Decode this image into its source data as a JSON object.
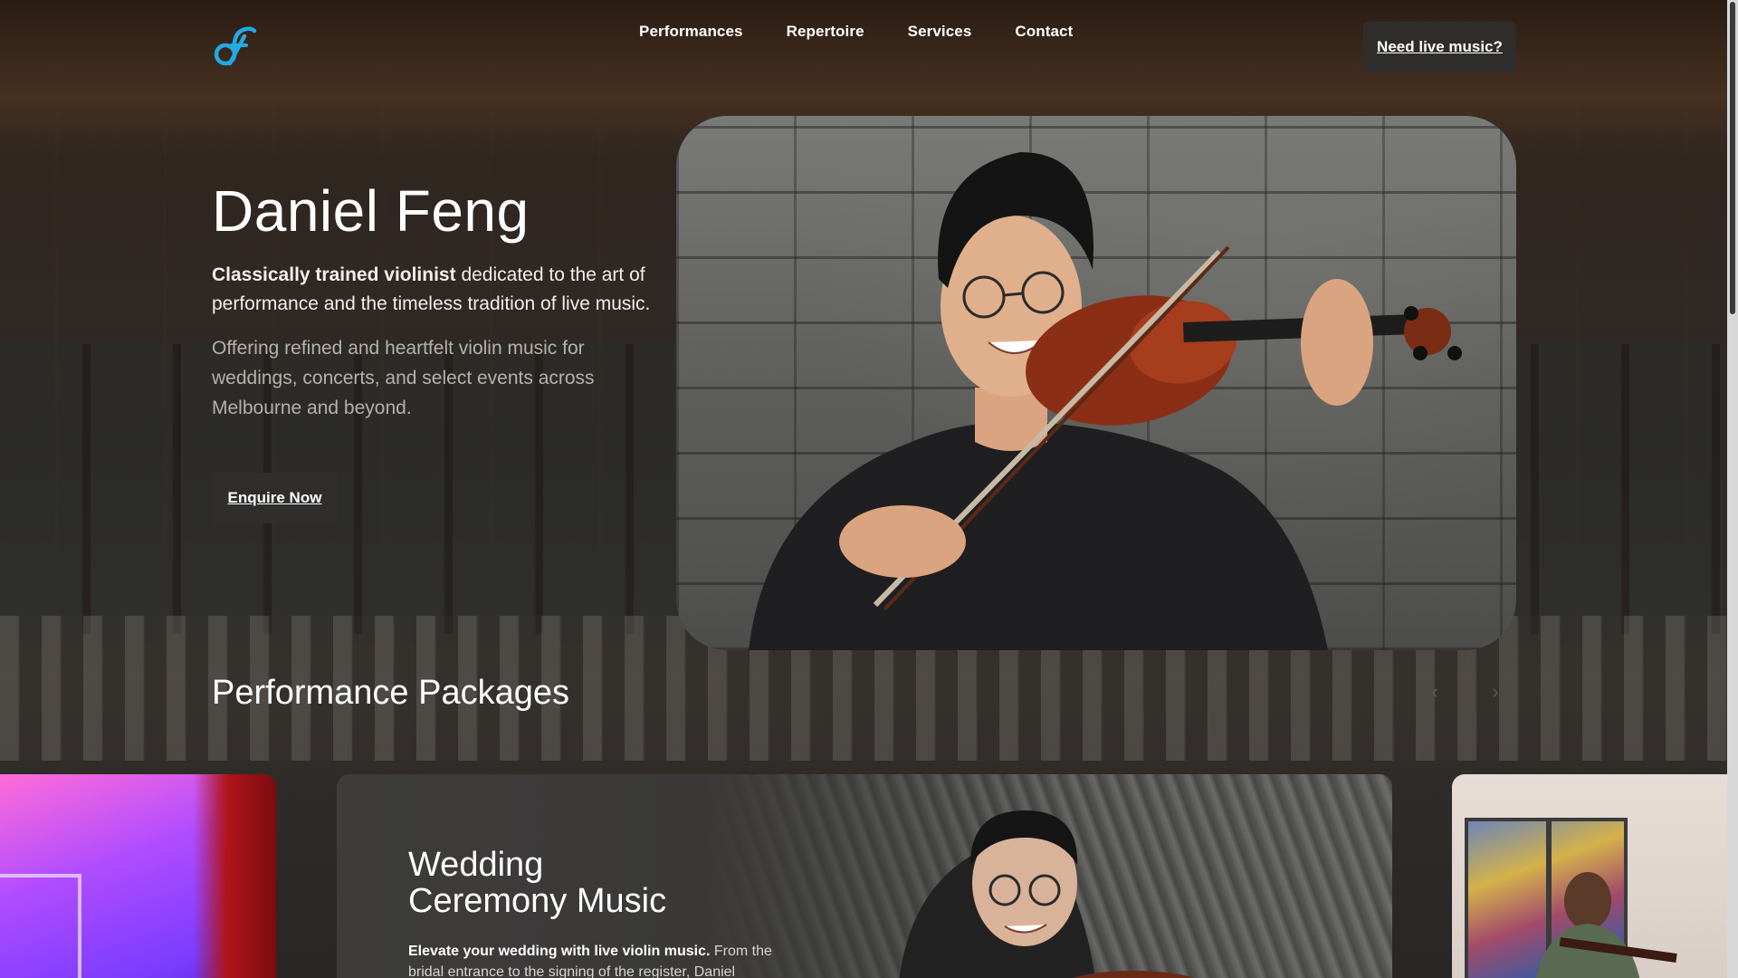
{
  "brand": {
    "logo_text": "df",
    "accent": "#23a9e6"
  },
  "nav": {
    "items": [
      {
        "label": "Performances"
      },
      {
        "label": "Repertoire"
      },
      {
        "label": "Services"
      },
      {
        "label": "Contact"
      }
    ],
    "cta_label": "Need live music?"
  },
  "hero": {
    "name": "Daniel Feng",
    "lead_bold": "Classically trained violinist",
    "lead_rest": " dedicated to the art of performance and the timeless tradition of live music.",
    "subtext": "Offering refined and heartfelt violin music for weddings, concerts, and select events across Melbourne and beyond.",
    "cta_label": "Enquire Now"
  },
  "packages": {
    "title": "Performance Packages",
    "prev_icon": "chevron-left-icon",
    "next_icon": "chevron-right-icon",
    "featured": {
      "title_line1": "Wedding",
      "title_line2": "Ceremony Music",
      "desc_bold": "Elevate your wedding with live violin music.",
      "desc_rest": " From the bridal entrance to the signing of the register, Daniel"
    }
  }
}
